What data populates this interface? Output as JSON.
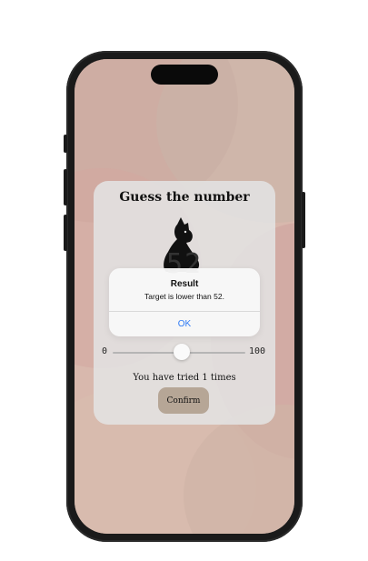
{
  "game": {
    "title": "Guess the number",
    "current_guess": "52",
    "slider": {
      "min_label": "0",
      "max_label": "100",
      "value": 52
    },
    "tries_text": "You have tried 1 times",
    "confirm_label": "Confirm"
  },
  "alert": {
    "title": "Result",
    "message": "Target is lower than 52.",
    "ok_label": "OK"
  },
  "colors": {
    "accent_blue": "#2f7bf5",
    "confirm_bg": "#b6a696",
    "wallpaper": "#d8b8ad"
  },
  "icons": {
    "mascot": "cat-silhouette-icon"
  }
}
